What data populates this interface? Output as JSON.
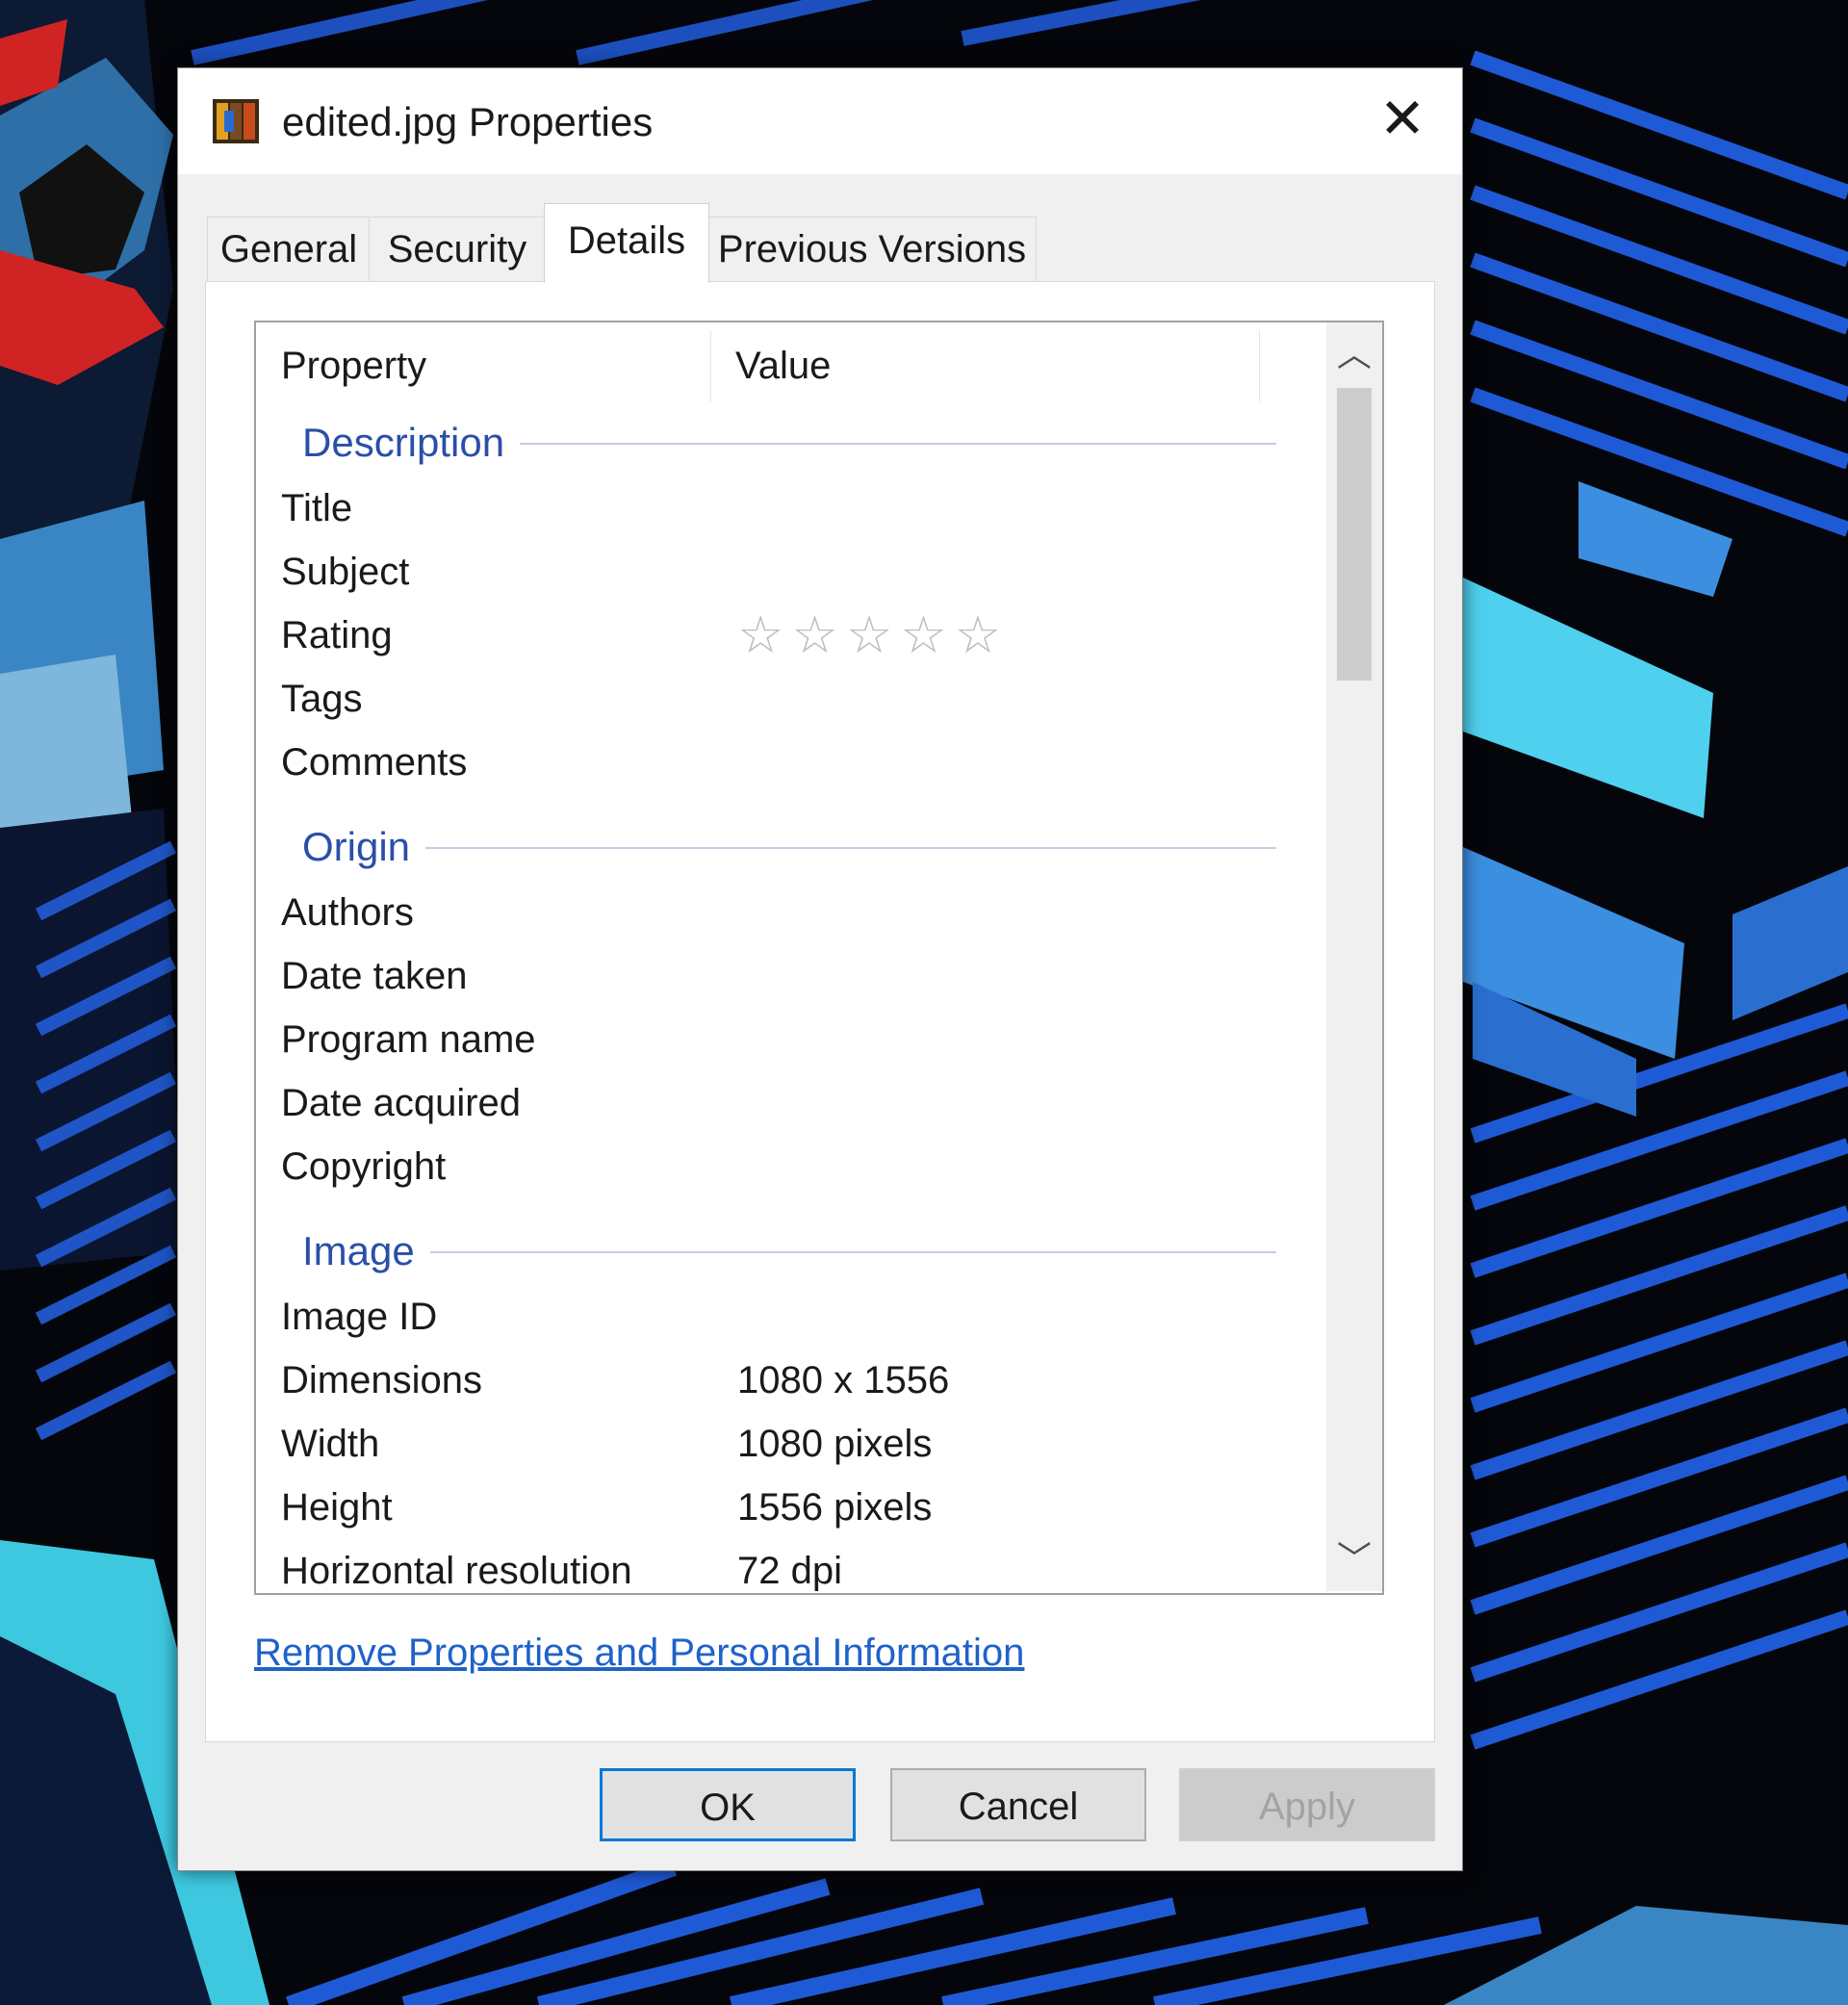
{
  "window": {
    "title": "edited.jpg Properties",
    "close_glyph": "✕"
  },
  "tabs": [
    {
      "label": "General",
      "active": false
    },
    {
      "label": "Security",
      "active": false
    },
    {
      "label": "Details",
      "active": true
    },
    {
      "label": "Previous Versions",
      "active": false
    }
  ],
  "list": {
    "columns": {
      "property": "Property",
      "value": "Value"
    },
    "groups": {
      "description": "Description",
      "origin": "Origin",
      "image": "Image"
    },
    "rows": {
      "title": {
        "property": "Title",
        "value": ""
      },
      "subject": {
        "property": "Subject",
        "value": ""
      },
      "rating": {
        "property": "Rating",
        "stars_filled": 0,
        "stars_total": 5,
        "star_glyph": "☆"
      },
      "tags": {
        "property": "Tags",
        "value": ""
      },
      "comments": {
        "property": "Comments",
        "value": ""
      },
      "authors": {
        "property": "Authors",
        "value": ""
      },
      "date_taken": {
        "property": "Date taken",
        "value": ""
      },
      "program_name": {
        "property": "Program name",
        "value": ""
      },
      "date_acquired": {
        "property": "Date acquired",
        "value": ""
      },
      "copyright": {
        "property": "Copyright",
        "value": ""
      },
      "image_id": {
        "property": "Image ID",
        "value": ""
      },
      "dimensions": {
        "property": "Dimensions",
        "value": "1080 x 1556"
      },
      "width": {
        "property": "Width",
        "value": "1080 pixels"
      },
      "height": {
        "property": "Height",
        "value": "1556 pixels"
      },
      "horizontal_resolution": {
        "property": "Horizontal resolution",
        "value": "72 dpi"
      }
    }
  },
  "scrollbar": {
    "up_glyph": "︿",
    "down_glyph": "﹀"
  },
  "link": {
    "remove_label": "Remove Properties and Personal Information"
  },
  "buttons": {
    "ok": "OK",
    "cancel": "Cancel",
    "apply": "Apply"
  },
  "colors": {
    "accent": "#0078d7",
    "group_header": "#2b4fa8",
    "link": "#1f62c9"
  }
}
